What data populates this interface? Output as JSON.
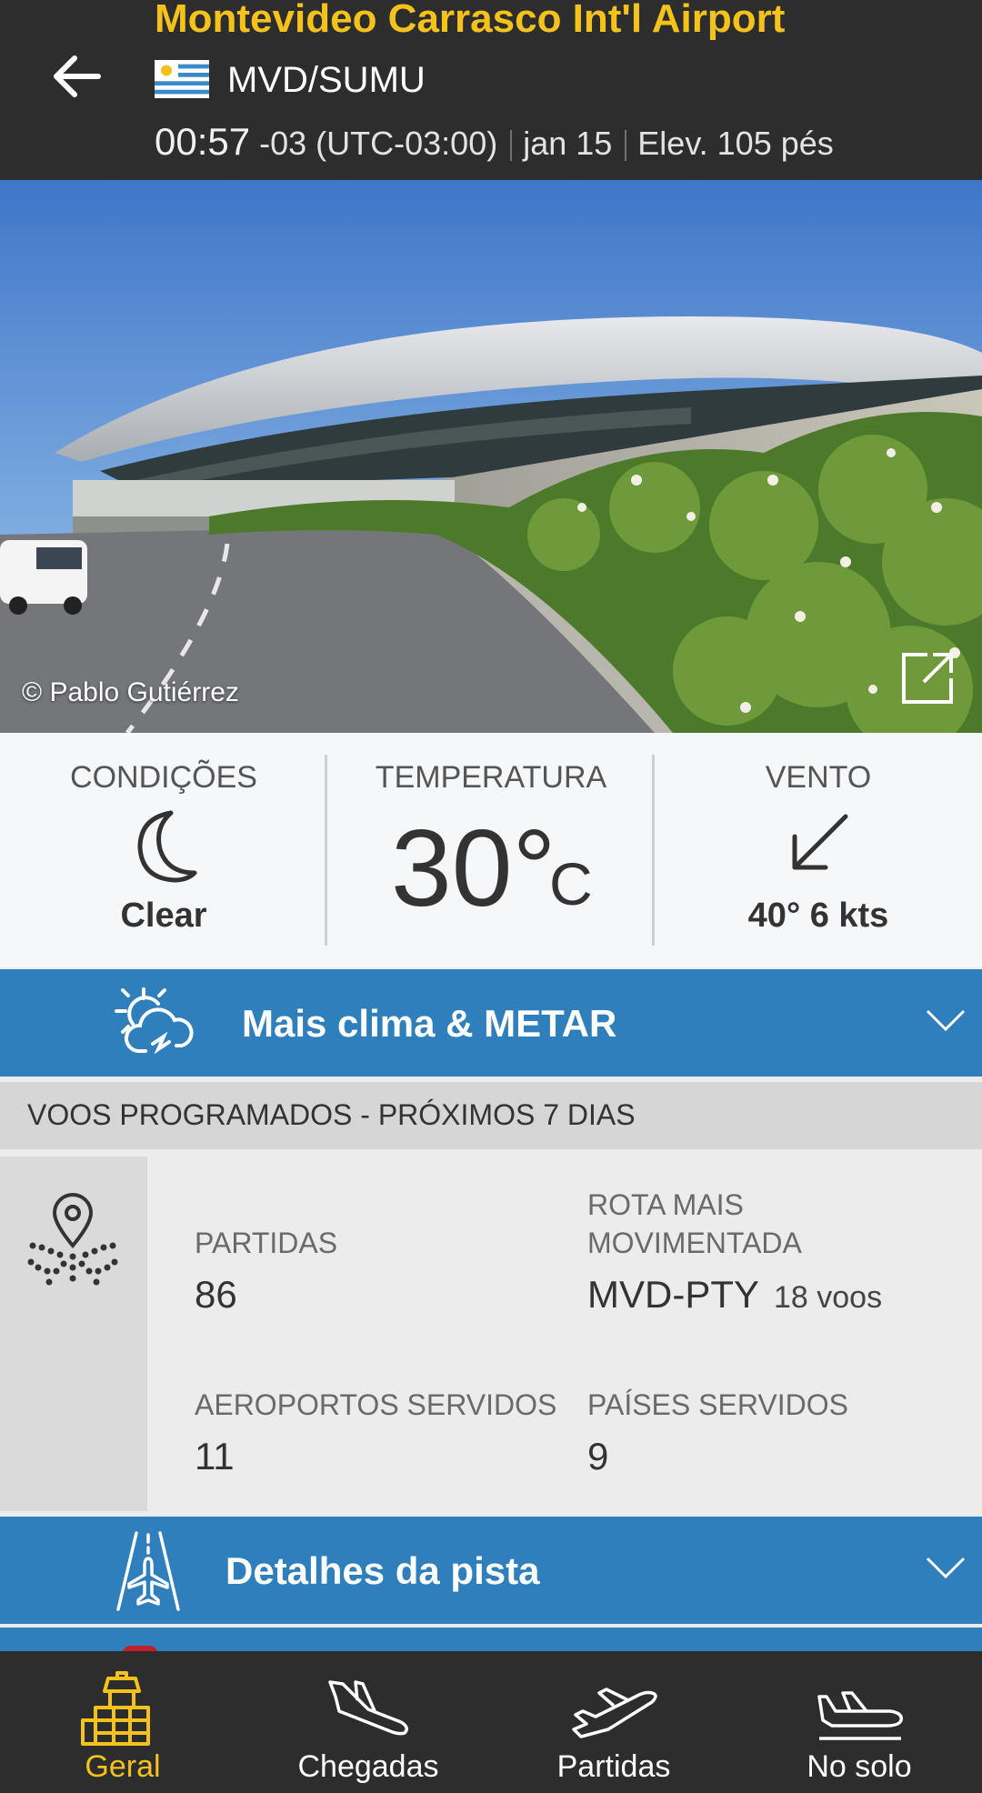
{
  "header": {
    "airport_name": "Montevideo Carrasco Int'l Airport",
    "codes": "MVD/SUMU",
    "local_time": "00:57",
    "tz": "-03 (UTC-03:00)",
    "date": "jan 15",
    "elevation": "Elev. 105 pés",
    "back_icon": "arrow-left-icon",
    "flag_icon": "uruguay-flag-icon"
  },
  "photo": {
    "credit": "© Pablo Gutiérrez",
    "expand_icon": "expand-icon"
  },
  "weather": {
    "conditions_label": "CONDIÇÕES",
    "conditions_value": "Clear",
    "conditions_icon": "moon-icon",
    "temperature_label": "TEMPERATURA",
    "temperature_value": "30°",
    "temperature_unit": "C",
    "wind_label": "VENTO",
    "wind_value": "40° 6 kts",
    "wind_icon": "arrow-down-left-icon"
  },
  "weather_bar": {
    "title": "Mais clima & METAR",
    "icon": "sun-cloud-icon"
  },
  "schedule": {
    "heading": "VOOS PROGRAMADOS - PRÓXIMOS 7 DIAS",
    "icon": "map-pin-routes-icon",
    "departures_label": "PARTIDAS",
    "departures_value": "86",
    "route_label_line1": "ROTA MAIS",
    "route_label_line2": "MOVIMENTADA",
    "route_value": "MVD-PTY",
    "route_count": "18 voos",
    "airports_label": "AEROPORTOS SERVIDOS",
    "airports_value": "11",
    "countries_label": "PAÍSES SERVIDOS",
    "countries_value": "9"
  },
  "runway_bar": {
    "title": "Detalhes da pista",
    "icon": "runway-plane-icon"
  },
  "bottom_nav": {
    "items": [
      {
        "label": "Geral",
        "icon": "airport-tower-icon",
        "active": true
      },
      {
        "label": "Chegadas",
        "icon": "plane-landing-icon",
        "active": false
      },
      {
        "label": "Partidas",
        "icon": "plane-takeoff-icon",
        "active": false
      },
      {
        "label": "No solo",
        "icon": "plane-ground-icon",
        "active": false
      }
    ]
  },
  "colors": {
    "accent": "#f5c21b",
    "header_bg": "#2d2d2d",
    "bar_blue": "#2f7fbd"
  }
}
